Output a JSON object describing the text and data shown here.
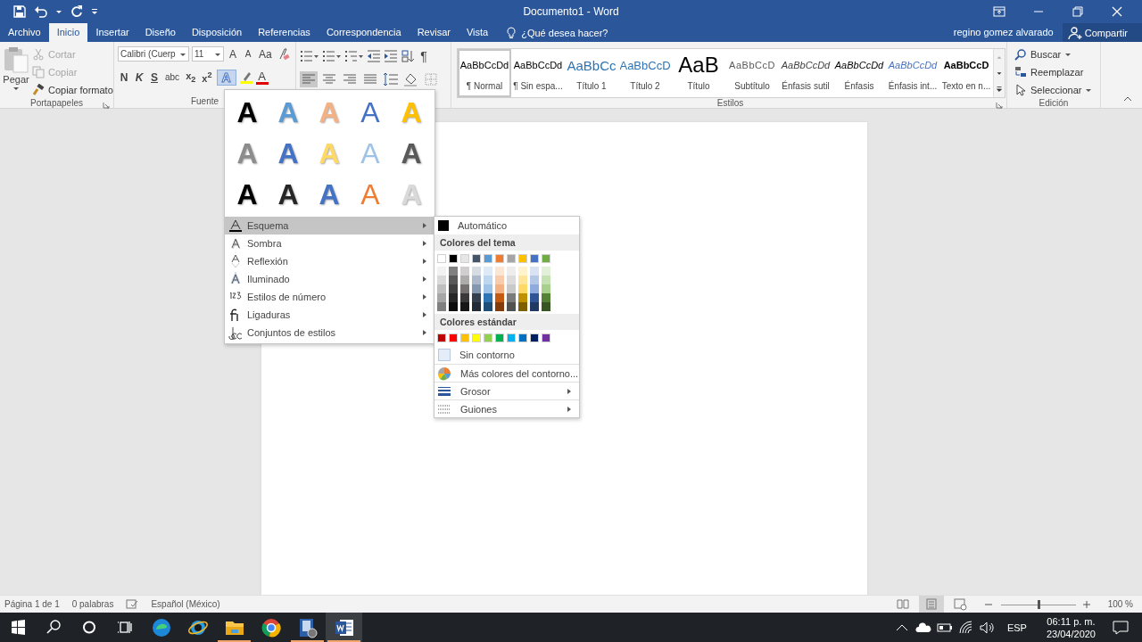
{
  "title_bar": {
    "title": "Documento1 - Word"
  },
  "tabs": [
    {
      "label": "Archivo",
      "selected": false
    },
    {
      "label": "Inicio",
      "selected": true
    },
    {
      "label": "Insertar",
      "selected": false
    },
    {
      "label": "Diseño",
      "selected": false
    },
    {
      "label": "Disposición",
      "selected": false
    },
    {
      "label": "Referencias",
      "selected": false
    },
    {
      "label": "Correspondencia",
      "selected": false
    },
    {
      "label": "Revisar",
      "selected": false
    },
    {
      "label": "Vista",
      "selected": false
    }
  ],
  "tell_me": {
    "placeholder": "¿Qué desea hacer?"
  },
  "user": "regino gomez alvarado",
  "share_button": "Compartir",
  "clipboard": {
    "label": "Portapapeles",
    "paste": "Pegar",
    "actions": [
      {
        "label": "Cortar",
        "kind": "cut",
        "disabled": true
      },
      {
        "label": "Copiar",
        "kind": "copy",
        "disabled": true
      },
      {
        "label": "Copiar formato",
        "kind": "format",
        "disabled": false
      }
    ]
  },
  "font": {
    "label": "Fuente",
    "font_name": "Calibri (Cuerp",
    "font_size": "11",
    "row1_buttons": [
      {
        "label": "A",
        "kind": "grow"
      },
      {
        "label": "A",
        "kind": "shrink"
      },
      {
        "label": "Aa",
        "kind": "case"
      }
    ],
    "row2_buttons": [
      {
        "label": "N",
        "kind": "bold"
      },
      {
        "label": "K",
        "kind": "italic"
      },
      {
        "label": "S",
        "kind": "underline"
      },
      {
        "label": "abc",
        "kind": "strike"
      },
      {
        "label": "x$_{2}$",
        "kind": "sub"
      },
      {
        "label": "x$^{2}$",
        "kind": "sup"
      }
    ],
    "effects_button": {
      "label": "A",
      "selected": true
    },
    "font_color_button": {
      "label": "A"
    }
  },
  "paragraph": {
    "row1": [
      {
        "kind": "bullets"
      },
      {
        "kind": "numbering"
      },
      {
        "kind": "multilevel"
      },
      {
        "kind": "outdent"
      },
      {
        "kind": "indent"
      },
      {
        "kind": "sort"
      },
      {
        "kind": "pilcrow",
        "label": "¶"
      }
    ],
    "row2": [
      {
        "kind": "align-left",
        "selected": true
      },
      {
        "kind": "align-center",
        "selected": false
      },
      {
        "kind": "align-right",
        "selected": false
      },
      {
        "kind": "justify",
        "selected": false
      },
      {
        "kind": "line-spacing",
        "selected": false
      },
      {
        "kind": "shading",
        "selected": false
      },
      {
        "kind": "borders",
        "selected": false
      }
    ]
  },
  "styles": {
    "label": "Estilos",
    "items": [
      {
        "preview": "AaBbCcDd",
        "name": "¶ Normal",
        "kind": "normal",
        "selected": true
      },
      {
        "preview": "AaBbCcDd",
        "name": "¶ Sin espa...",
        "kind": "normal",
        "selected": false
      },
      {
        "preview": "AaBbCc",
        "name": "Título 1",
        "kind": "heading1",
        "selected": false
      },
      {
        "preview": "AaBbCcD",
        "name": "Título 2",
        "kind": "heading2",
        "selected": false
      },
      {
        "preview": "AaB",
        "name": "Título",
        "kind": "title",
        "selected": false
      },
      {
        "preview": "AaBbCcD",
        "name": "Subtítulo",
        "kind": "subtitle",
        "selected": false
      },
      {
        "preview": "AaBbCcDd",
        "name": "Énfasis sutil",
        "kind": "subtle",
        "selected": false
      },
      {
        "preview": "AaBbCcDd",
        "name": "Énfasis",
        "kind": "emphasis",
        "selected": false
      },
      {
        "preview": "AaBbCcDd",
        "name": "Énfasis int...",
        "kind": "intense",
        "selected": false
      },
      {
        "preview": "AaBbCcD",
        "name": "Texto en n...",
        "kind": "strong",
        "selected": false
      }
    ]
  },
  "editing": {
    "label": "Edición",
    "items": [
      {
        "label": "Buscar",
        "kind": "find"
      },
      {
        "label": "Reemplazar",
        "kind": "replace"
      },
      {
        "label": "Seleccionar",
        "kind": "select"
      }
    ]
  },
  "effects_menu": {
    "gallery": [
      {
        "label": "A",
        "kind": "fill",
        "color": "#000000"
      },
      {
        "label": "A",
        "kind": "fill",
        "color": "#5b9bd5"
      },
      {
        "label": "A",
        "kind": "fill",
        "color": "#f4b183"
      },
      {
        "label": "A",
        "kind": "outline",
        "color": "#4472c4"
      },
      {
        "label": "A",
        "kind": "fill",
        "color": "#ffc000"
      },
      {
        "label": "A",
        "kind": "fill",
        "color": "#8c8c8c"
      },
      {
        "label": "A",
        "kind": "fill",
        "color": "#4472c4"
      },
      {
        "label": "A",
        "kind": "fill",
        "color": "#ffd965"
      },
      {
        "label": "A",
        "kind": "outline",
        "color": "#9dc3e6"
      },
      {
        "label": "A",
        "kind": "fill",
        "color": "#595959"
      },
      {
        "label": "A",
        "kind": "fill",
        "color": "#000000"
      },
      {
        "label": "A",
        "kind": "fill",
        "color": "#262626"
      },
      {
        "label": "A",
        "kind": "fill",
        "color": "#4472c4"
      },
      {
        "label": "A",
        "kind": "outline",
        "color": "#ed7d31"
      },
      {
        "label": "A",
        "kind": "fill",
        "color": "#d9d9d9"
      }
    ],
    "items": [
      {
        "label": "Esquema",
        "kind": "outline",
        "selected": true
      },
      {
        "label": "Sombra",
        "kind": "shadow",
        "selected": false
      },
      {
        "label": "Reflexión",
        "kind": "reflection",
        "selected": false
      },
      {
        "label": "Iluminado",
        "kind": "glow",
        "selected": false
      },
      {
        "label": "Estilos de número",
        "kind": "numbers",
        "selected": false
      },
      {
        "label": "Ligaduras",
        "kind": "ligatures",
        "selected": false
      },
      {
        "label": "Conjuntos de estilos",
        "kind": "sets",
        "selected": false
      }
    ]
  },
  "outline_menu": {
    "automatic": "Automático",
    "theme_header": "Colores del tema",
    "theme_colors": [
      {
        "color": "#ffffff",
        "shades": [
          {
            "color": "#f2f2f2"
          },
          {
            "color": "#d9d9d9"
          },
          {
            "color": "#bfbfbf"
          },
          {
            "color": "#a6a6a6"
          },
          {
            "color": "#808080"
          }
        ]
      },
      {
        "color": "#000000",
        "shades": [
          {
            "color": "#808080"
          },
          {
            "color": "#595959"
          },
          {
            "color": "#404040"
          },
          {
            "color": "#262626"
          },
          {
            "color": "#0d0d0d"
          }
        ]
      },
      {
        "color": "#e7e6e6",
        "shades": [
          {
            "color": "#d0cece"
          },
          {
            "color": "#aeabab"
          },
          {
            "color": "#757171"
          },
          {
            "color": "#3a3838"
          },
          {
            "color": "#171616"
          }
        ]
      },
      {
        "color": "#44546a",
        "shades": [
          {
            "color": "#d6dce4"
          },
          {
            "color": "#adb9ca"
          },
          {
            "color": "#8497b0"
          },
          {
            "color": "#333f4f"
          },
          {
            "color": "#222a35"
          }
        ]
      },
      {
        "color": "#5b9bd5",
        "shades": [
          {
            "color": "#deebf6"
          },
          {
            "color": "#bdd7ee"
          },
          {
            "color": "#9dc3e6"
          },
          {
            "color": "#2e75b5"
          },
          {
            "color": "#1f4e79"
          }
        ]
      },
      {
        "color": "#ed7d31",
        "shades": [
          {
            "color": "#fbe5d5"
          },
          {
            "color": "#f7cbac"
          },
          {
            "color": "#f4b183"
          },
          {
            "color": "#c55a11"
          },
          {
            "color": "#843c0b"
          }
        ]
      },
      {
        "color": "#a5a5a5",
        "shades": [
          {
            "color": "#ededed"
          },
          {
            "color": "#dbdbdb"
          },
          {
            "color": "#c9c9c9"
          },
          {
            "color": "#7b7b7b"
          },
          {
            "color": "#525252"
          }
        ]
      },
      {
        "color": "#ffc000",
        "shades": [
          {
            "color": "#fff2cc"
          },
          {
            "color": "#fee599"
          },
          {
            "color": "#ffd965"
          },
          {
            "color": "#bf9000"
          },
          {
            "color": "#7f6000"
          }
        ]
      },
      {
        "color": "#4472c4",
        "shades": [
          {
            "color": "#dae3f3"
          },
          {
            "color": "#b4c7e7"
          },
          {
            "color": "#8faadc"
          },
          {
            "color": "#2f5597"
          },
          {
            "color": "#203864"
          }
        ]
      },
      {
        "color": "#70ad47",
        "shades": [
          {
            "color": "#e2efd9"
          },
          {
            "color": "#c5e0b3"
          },
          {
            "color": "#a8d08d"
          },
          {
            "color": "#538135"
          },
          {
            "color": "#375623"
          }
        ]
      }
    ],
    "standard_header": "Colores estándar",
    "standard_colors": [
      {
        "color": "#c00000"
      },
      {
        "color": "#ff0000"
      },
      {
        "color": "#ffc000"
      },
      {
        "color": "#ffff00"
      },
      {
        "color": "#92d050"
      },
      {
        "color": "#00b050"
      },
      {
        "color": "#00b0f0"
      },
      {
        "color": "#0070c0"
      },
      {
        "color": "#002060"
      },
      {
        "color": "#7030a0"
      }
    ],
    "items": [
      {
        "label": "Sin contorno",
        "kind": "none"
      },
      {
        "label": "Más colores del contorno...",
        "kind": "more"
      },
      {
        "label": "Grosor",
        "kind": "weight"
      },
      {
        "label": "Guiones",
        "kind": "dashes"
      }
    ]
  },
  "status_bar": {
    "page": "Página 1 de 1",
    "words": "0 palabras",
    "language": "Español (México)",
    "views": [
      {
        "kind": "read",
        "selected": false
      },
      {
        "kind": "print",
        "selected": true
      },
      {
        "kind": "web",
        "selected": false
      }
    ],
    "zoom": {
      "level": 0.5,
      "reading": "100 %"
    }
  },
  "taskbar": {
    "apps": [
      {
        "kind": "edge",
        "running": false,
        "selected": false
      },
      {
        "kind": "ie",
        "running": false,
        "selected": false
      },
      {
        "kind": "explorer",
        "running": true,
        "selected": false
      },
      {
        "kind": "chrome",
        "running": false,
        "selected": false
      },
      {
        "kind": "media",
        "running": true,
        "selected": false
      },
      {
        "kind": "word",
        "running": true,
        "selected": true
      }
    ],
    "language": "ESP",
    "time": "06:11 p. m.",
    "date": "23/04/2020"
  }
}
